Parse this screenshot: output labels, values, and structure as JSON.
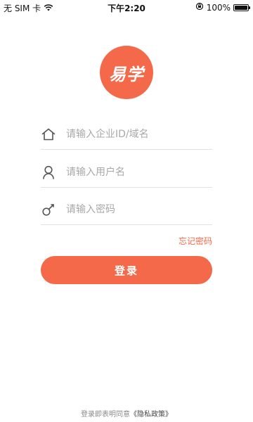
{
  "status_bar": {
    "carrier": "无 SIM 卡",
    "time": "下午2:20",
    "battery": "100%",
    "battery_level": 1.0
  },
  "logo": {
    "text": "易学",
    "color": "#f4694a"
  },
  "form": {
    "company_placeholder": "请输入企业ID/域名",
    "company_value": "",
    "username_placeholder": "请输入用户名",
    "username_value": "",
    "password_placeholder": "请输入密码",
    "password_value": "",
    "forgot_password": "忘记密码",
    "login_button": "登录"
  },
  "footer": {
    "agreement_text": "登录即表明同意",
    "privacy_link": "《隐私政策》"
  },
  "accent_color": "#f4694a",
  "icons": [
    "wifi-icon",
    "lock-rotation-icon",
    "battery-icon",
    "home-icon",
    "user-icon",
    "key-icon"
  ]
}
